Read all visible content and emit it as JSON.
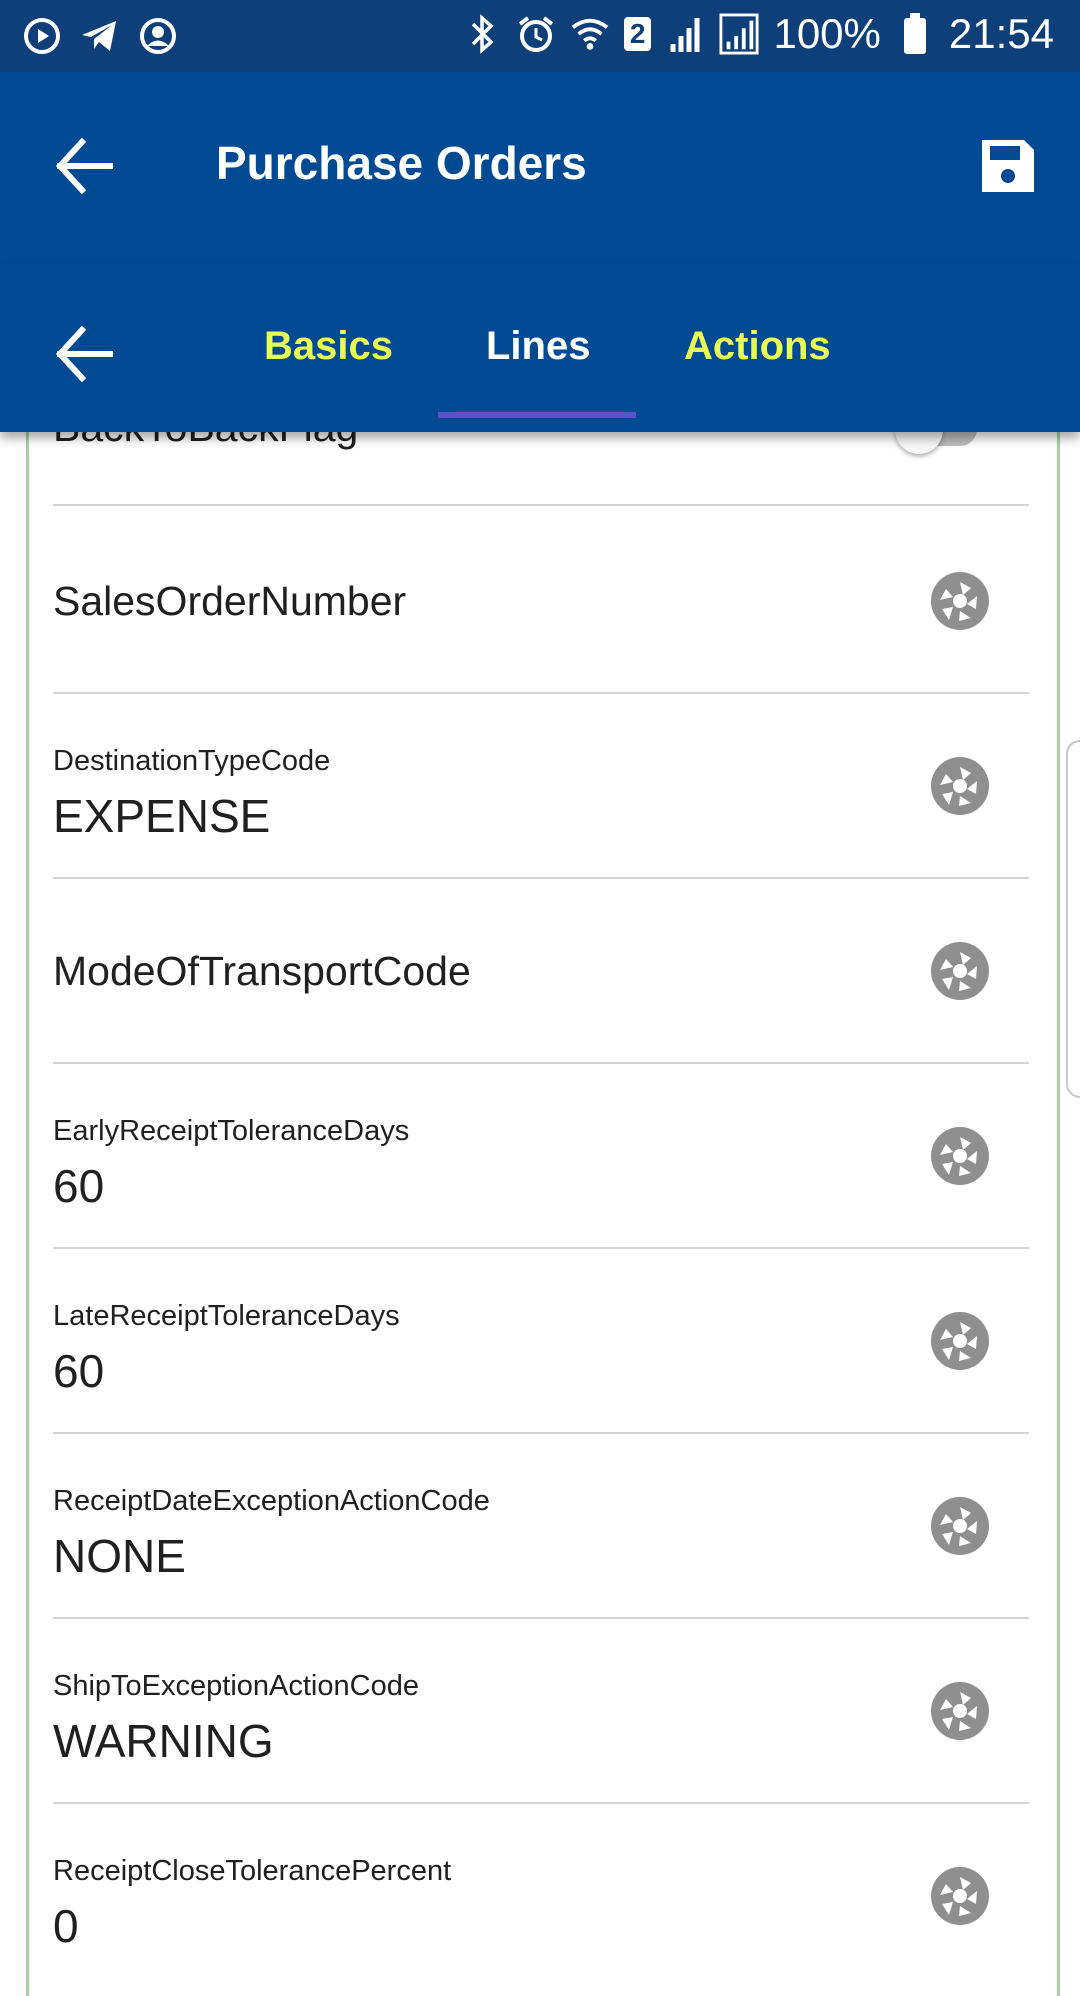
{
  "status_bar": {
    "battery": "100%",
    "time": "21:54",
    "sim_badge": "2"
  },
  "app_bar": {
    "title": "Purchase Orders"
  },
  "tabs": [
    {
      "label": "Basics",
      "active": false
    },
    {
      "label": "Lines",
      "active": true
    },
    {
      "label": "Actions",
      "active": false
    }
  ],
  "fields": {
    "back_to_back": {
      "label": "BackToBackFlag",
      "value": false
    },
    "sales_order_number": {
      "label": "SalesOrderNumber",
      "value": ""
    },
    "destination_type_code": {
      "label": "DestinationTypeCode",
      "value": "EXPENSE"
    },
    "mode_of_transport_code": {
      "label": "ModeOfTransportCode",
      "value": ""
    },
    "early_receipt_tolerance_days": {
      "label": "EarlyReceiptToleranceDays",
      "value": "60"
    },
    "late_receipt_tolerance_days": {
      "label": "LateReceiptToleranceDays",
      "value": "60"
    },
    "receipt_date_exception_action_code": {
      "label": "ReceiptDateExceptionActionCode",
      "value": "NONE"
    },
    "ship_to_exception_action_code": {
      "label": "ShipToExceptionActionCode",
      "value": "WARNING"
    },
    "receipt_close_tolerance_percent": {
      "label": "ReceiptCloseTolerancePercent",
      "value": "0"
    }
  },
  "colors": {
    "status_bar": "#0e3f78",
    "app_bar": "#004a94",
    "tab_inactive": "#e8ff52",
    "tab_indicator": "#5a53c8",
    "card_border": "#a6d2a6"
  },
  "icons": {
    "field_action": "aperture-icon",
    "save": "save-icon",
    "back": "arrow-left-icon"
  }
}
